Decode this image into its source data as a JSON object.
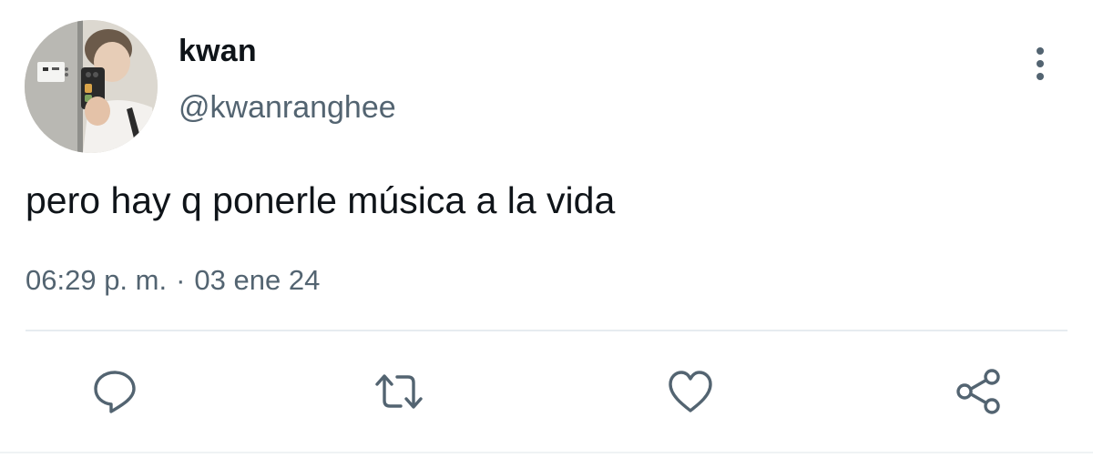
{
  "tweet": {
    "author": {
      "display_name": "kwan",
      "handle": "@kwanranghee",
      "avatar": "avatar-photo"
    },
    "text": "pero hay q ponerle música a la vida",
    "time": "06:29 p. m.",
    "separator": "·",
    "date": "03 ene 24",
    "more_icon": "more-vertical-icon"
  },
  "actions": [
    {
      "name": "reply",
      "icon": "reply-icon"
    },
    {
      "name": "retweet",
      "icon": "retweet-icon"
    },
    {
      "name": "like",
      "icon": "heart-icon"
    },
    {
      "name": "share",
      "icon": "share-icon"
    }
  ],
  "colors": {
    "text": "#0f1419",
    "secondary": "#536471",
    "icon": "#536471",
    "divider": "#e6ecf0"
  }
}
